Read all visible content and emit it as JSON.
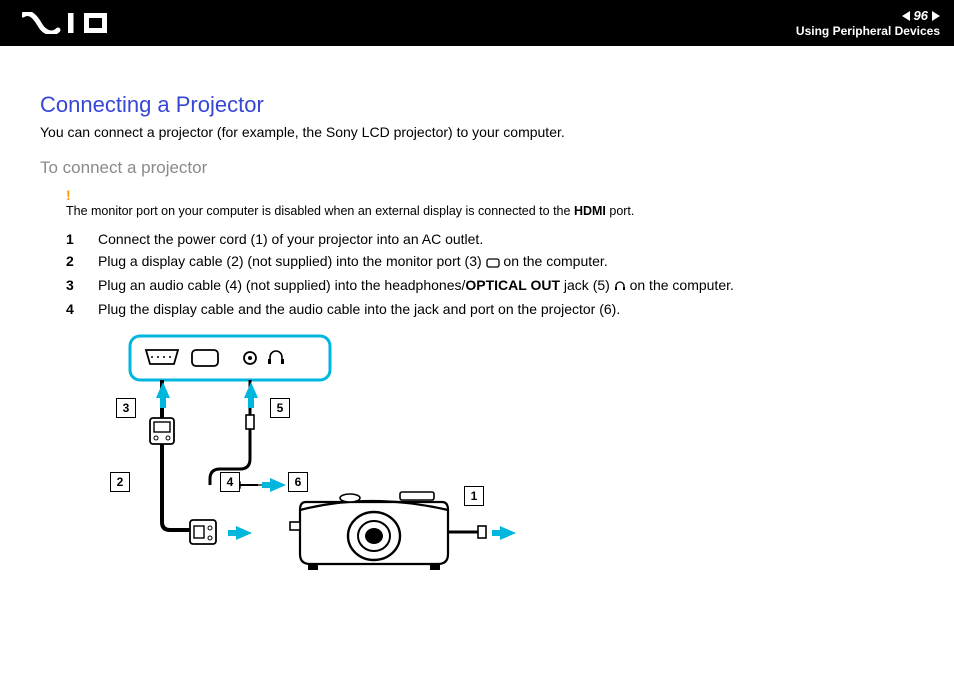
{
  "header": {
    "page_number": "96",
    "chapter": "Using Peripheral Devices"
  },
  "section": {
    "title": "Connecting a Projector",
    "intro": "You can connect a projector (for example, the Sony LCD projector) to your computer.",
    "subtitle": "To connect a projector"
  },
  "note": {
    "bang": "!",
    "pre": "The monitor port on your computer is disabled when an external display is connected to the ",
    "bold": "HDMI",
    "post": " port."
  },
  "steps": [
    {
      "n": "1",
      "text": "Connect the power cord (1) of your projector into an AC outlet."
    },
    {
      "n": "2",
      "pre": "Plug a display cable (2) (not supplied) into the monitor port (3) ",
      "icon": "monitor",
      "post": " on the computer."
    },
    {
      "n": "3",
      "pre": "Plug an audio cable (4) (not supplied) into the headphones/",
      "bold": "OPTICAL OUT",
      "mid": " jack (5) ",
      "icon": "headphones",
      "post": " on the computer."
    },
    {
      "n": "4",
      "text": "Plug the display cable and the audio cable into the jack and port on the projector (6)."
    }
  ],
  "diagram": {
    "callouts": {
      "c1": "1",
      "c2": "2",
      "c3": "3",
      "c4": "4",
      "c5": "5",
      "c6": "6"
    }
  }
}
